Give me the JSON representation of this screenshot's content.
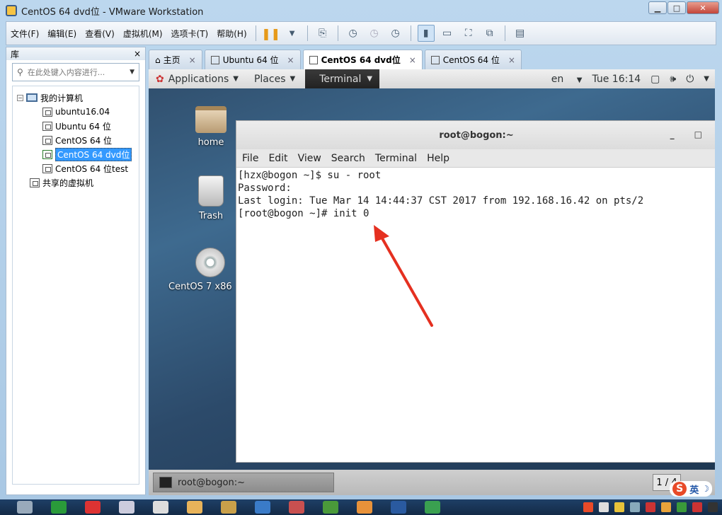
{
  "window": {
    "title": "CentOS 64 dvd位 - VMware Workstation",
    "minimize": "▁",
    "maximize": "□",
    "close": "✕"
  },
  "menubar": {
    "items": [
      "文件(F)",
      "编辑(E)",
      "查看(V)",
      "虚拟机(M)",
      "选项卡(T)",
      "帮助(H)"
    ]
  },
  "library": {
    "title": "库",
    "close": "×",
    "search_placeholder": "在此处键入内容进行...",
    "tree": {
      "root": "我的计算机",
      "vms": [
        "ubuntu16.04",
        "Ubuntu 64 位",
        "CentOS 64 位",
        "CentOS 64 dvd位",
        "CentOS 64 位test"
      ],
      "selected": "CentOS 64 dvd位",
      "shared": "共享的虚拟机"
    }
  },
  "tabs": [
    {
      "label": "主页",
      "active": false
    },
    {
      "label": "Ubuntu 64 位",
      "active": false
    },
    {
      "label": "CentOS 64 dvd位",
      "active": true
    },
    {
      "label": "CentOS 64 位",
      "active": false
    }
  ],
  "gnome": {
    "applications": "Applications",
    "places": "Places",
    "terminal": "Terminal",
    "lang": "en",
    "clock": "Tue 16:14"
  },
  "desktop_icons": [
    "home",
    "Trash",
    "CentOS 7 x86"
  ],
  "terminal": {
    "title": "root@bogon:~",
    "min": "_",
    "max": "□",
    "menu": [
      "File",
      "Edit",
      "View",
      "Search",
      "Terminal",
      "Help"
    ],
    "lines": [
      "[hzx@bogon ~]$ su - root",
      "Password:",
      "Last login: Tue Mar 14 14:44:37 CST 2017 from 192.168.16.42 on pts/2",
      "[root@bogon ~]# init 0"
    ]
  },
  "guest_taskbar": {
    "item": "root@bogon:~",
    "workspace": "1 / 4"
  },
  "ime": {
    "lang": "英",
    "logo": "S"
  },
  "colors": {
    "accent": "#3399ff",
    "arrow": "#e53020"
  }
}
